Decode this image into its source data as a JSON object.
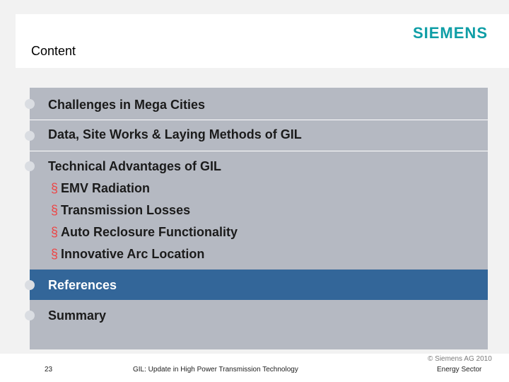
{
  "header": {
    "title": "Content",
    "logo": "SIEMENS"
  },
  "agenda": {
    "items": [
      {
        "label": "Challenges in Mega Cities"
      },
      {
        "label": "Data, Site Works & Laying Methods of GIL"
      },
      {
        "label": "Technical Advantages of GIL",
        "subitems": [
          "EMV Radiation",
          "Transmission Losses",
          "Auto Reclosure Functionality",
          "Innovative Arc Location"
        ]
      },
      {
        "label": "References",
        "active": true
      },
      {
        "label": "Summary"
      }
    ],
    "sub_marker": "§"
  },
  "footer": {
    "page_number": "23",
    "subtitle": "GIL: Update in High Power Transmission Technology",
    "copyright": "© Siemens AG 2010",
    "department": "Energy Sector"
  },
  "colors": {
    "accent": "#336699",
    "panel": "#b5b9c2",
    "logo": "#0f9ea6"
  }
}
